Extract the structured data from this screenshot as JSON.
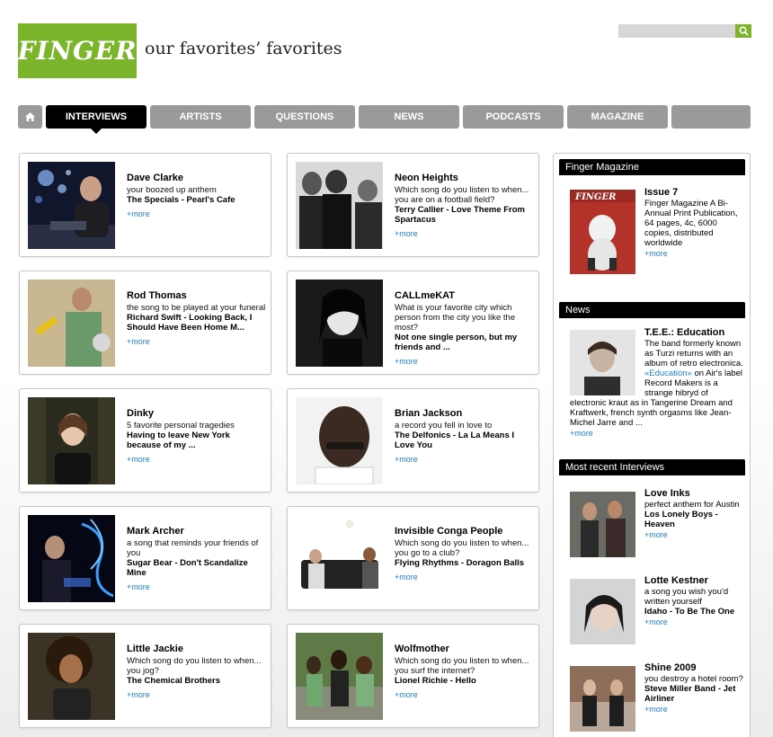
{
  "header": {
    "logo": "FINGER",
    "tagline": "our favorites’ favorites",
    "search_placeholder": ""
  },
  "nav": {
    "tabs": [
      "INTERVIEWS",
      "ARTISTS",
      "QUESTIONS",
      "NEWS",
      "PODCASTS",
      "MAGAZINE"
    ],
    "active": "INTERVIEWS"
  },
  "more_label": "+more",
  "interviews": [
    {
      "name": "Dave Clarke",
      "question": "your boozed up anthem",
      "answer": "The Specials - Pearl's Cafe"
    },
    {
      "name": "Neon Heights",
      "question": "Which song do you listen to when... you are on a football field?",
      "answer": "Terry Callier - Love Theme From Spartacus"
    },
    {
      "name": "Rod Thomas",
      "question": "the song to be played at your funeral",
      "answer": "Richard Swift - Looking Back, I Should Have Been Home M..."
    },
    {
      "name": "CALLmeKAT",
      "question": "What is your favorite city which person from the city you like the most?",
      "answer": "Not one single person, but my friends and ..."
    },
    {
      "name": "Dinky",
      "question": "5 favorite personal tragedies",
      "answer": "Having to leave New York because of my ..."
    },
    {
      "name": "Brian Jackson",
      "question": "a record you fell in love to",
      "answer": "The Delfonics - La La Means I Love You"
    },
    {
      "name": "Mark Archer",
      "question": "a song that reminds your friends of you",
      "answer": "Sugar Bear - Don't Scandalize Mine"
    },
    {
      "name": "Invisible Conga People",
      "question": "Which song do you listen to when... you go to a club?",
      "answer": "Flying Rhythms - Doragon Balls"
    },
    {
      "name": "Little Jackie",
      "question": "Which song do you listen to when... you jog?",
      "answer": "The Chemical Brothers"
    },
    {
      "name": "Wolfmother",
      "question": "Which song do you listen to when... you surf the internet?",
      "answer": "Lionel Richie - Hello"
    }
  ],
  "sidebar": {
    "magazine": {
      "heading": "Finger Magazine",
      "title": "Issue 7",
      "text": "Finger Magazine A Bi-Annual Print Publication, 64 pages, 4c, 6000 copies, distributed worldwide",
      "cover_label": "FINGER"
    },
    "news": {
      "heading": "News",
      "title": "T.E.E.: Education",
      "text_before": "The band formerly known as Turzi returns with an album of retro electronica. ",
      "link": "«Education»",
      "text_after": " on Air's label Record Makers is a strange hibryd of electronic kraut as in Tangerine Dream and Kraftwerk, french synth orgasms like Jean-Michel Jarre and ..."
    },
    "recent": {
      "heading": "Most recent Interviews",
      "items": [
        {
          "name": "Love Inks",
          "question": "perfect anthem for Austin",
          "answer": "Los Lonely Boys - Heaven"
        },
        {
          "name": "Lotte Kestner",
          "question": "a song you wish you'd written yourself",
          "answer": "Idaho - To Be The One"
        },
        {
          "name": "Shine 2009",
          "question": "you destroy a hotel room?",
          "answer": "Steve Miller Band - Jet Airliner"
        }
      ]
    }
  },
  "colors": {
    "brand_green": "#7ab52b",
    "tab_gray": "#9a9a9a",
    "tab_active": "#000000",
    "link_blue": "#1f7fc9"
  }
}
